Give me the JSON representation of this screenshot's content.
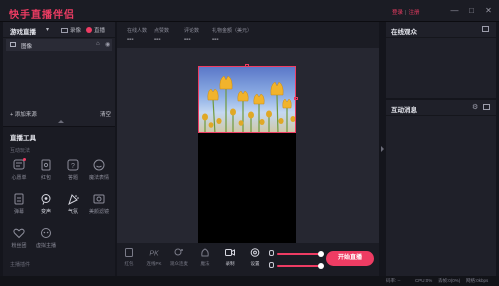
{
  "app": {
    "title": "快手直播伴侣"
  },
  "auth": {
    "login": "登录",
    "separator": "|",
    "register": "注册"
  },
  "window_controls": {
    "minimize": "—",
    "maximize": "□",
    "close": "✕"
  },
  "left_panel": {
    "mode_title": "游戏直播",
    "mode_dropdown": "▾",
    "record_label": "录像",
    "live_label": "直播",
    "sources": [
      {
        "label": "图像"
      }
    ],
    "add_source": "+ 添加来源",
    "clear": "清空"
  },
  "tools": {
    "title": "直播工具",
    "section_interaction": "互动玩法",
    "section_extensions": "主播插件",
    "items": [
      {
        "label": "心愿单",
        "icon": "wish-icon",
        "badge": true
      },
      {
        "label": "红包",
        "icon": "red-packet-icon"
      },
      {
        "label": "答题",
        "icon": "quiz-icon"
      },
      {
        "label": "魔法表情",
        "icon": "magic-face-icon"
      },
      {
        "label": "弹幕",
        "icon": "danmaku-icon"
      },
      {
        "label": "变声",
        "icon": "voice-change-icon",
        "active": true
      },
      {
        "label": "气氛",
        "icon": "atmosphere-icon",
        "active": true
      },
      {
        "label": "美颜滤镜",
        "icon": "beauty-filter-icon"
      },
      {
        "label": "粉丝团",
        "icon": "fan-club-icon"
      },
      {
        "label": "虚拟主播",
        "icon": "virtual-anchor-icon"
      }
    ]
  },
  "stats": [
    {
      "label": "在线人数",
      "value": "---"
    },
    {
      "label": "点赞数",
      "value": "---"
    },
    {
      "label": "评论数",
      "value": "---"
    },
    {
      "label": "礼物金额（美元）",
      "value": "---"
    }
  ],
  "bottom_toolbar": {
    "items": [
      {
        "label": "红包",
        "icon": "red-packet-icon"
      },
      {
        "label": "连线PK",
        "icon": "pk-icon"
      },
      {
        "label": "观众连麦",
        "icon": "audience-mic-icon"
      },
      {
        "label": "魔法",
        "icon": "magic-icon"
      },
      {
        "label": "录制",
        "icon": "record-icon",
        "bright": true
      },
      {
        "label": "设置",
        "icon": "settings-icon",
        "bright": true
      }
    ],
    "mic_volume": 1.0,
    "speaker_volume": 1.0,
    "start_live": "开始直播"
  },
  "status_bar": {
    "items": [
      "码率: --",
      "CPU:0%",
      "丢帧:0(0%)",
      "网络:0kbps"
    ]
  },
  "right_panels": {
    "audience_title": "在线观众",
    "messages_title": "互动消息"
  },
  "colors": {
    "accent": "#ee3c63",
    "background": "#14151c",
    "panel": "#1f2029"
  }
}
